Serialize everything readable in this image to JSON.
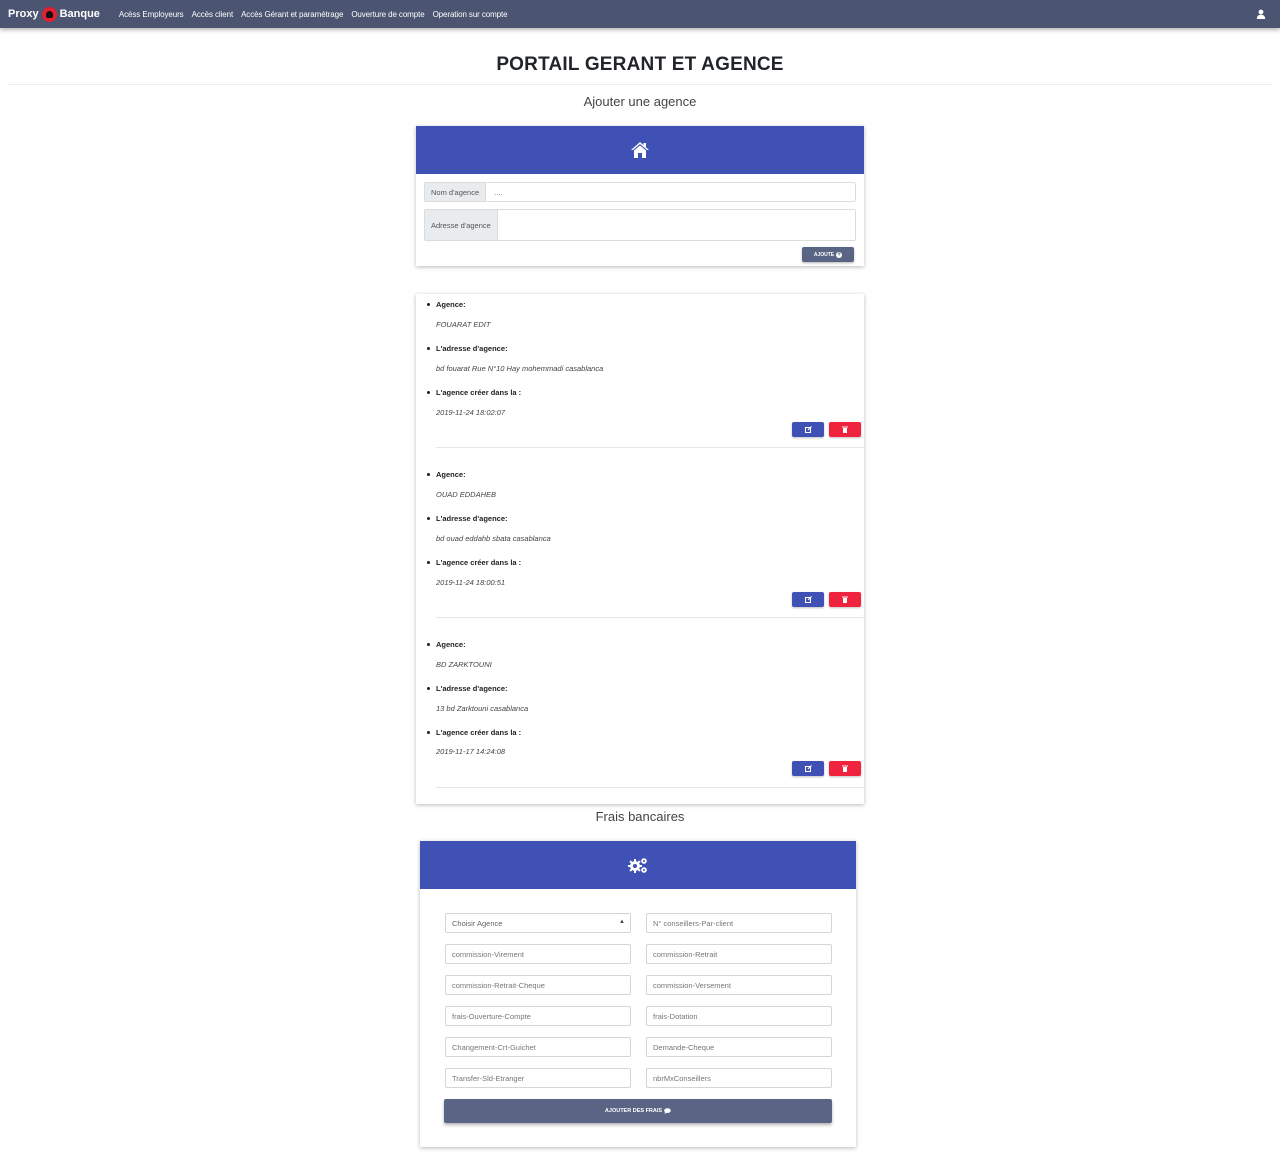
{
  "nav": {
    "brand_left": "Proxy",
    "brand_right": "Banque",
    "links": [
      "Acèss Employeurs",
      "Accès client",
      "Accès Gérant et paramétrage",
      "Ouverture de compte",
      "Operation sur compte"
    ]
  },
  "page": {
    "title": "PORTAIL GERANT ET AGENCE",
    "add_agency_title": "Ajouter une agence",
    "frais_title": "Frais bancaires"
  },
  "agency_form": {
    "name_label": "Nom d'agence",
    "name_placeholder": "....",
    "address_label": "Adresse d'agence",
    "submit_label": "AJOUTE"
  },
  "agency_fields": {
    "name_label": "Agence:",
    "address_label": "L'adresse d'agence:",
    "date_label": "L'agence créer dans la :"
  },
  "agencies": [
    {
      "name": "FOUARAT EDIT",
      "address": "bd fouarat Rue N°10 Hay mohemmadi casablanca",
      "created": "2019-11-24 18:02:07"
    },
    {
      "name": "OUAD EDDAHEB",
      "address": "bd ouad eddahb sbata casablanca",
      "created": "2019-11-24 18:00:51"
    },
    {
      "name": "BD ZARKTOUNI",
      "address": "13 bd Zarktouni casablanca",
      "created": "2019-11-17 14:24:08"
    }
  ],
  "frais_form": {
    "select_label": "Choisir Agence",
    "fields": [
      "N° conseillers-Par-client",
      "commission-Virement",
      "commission-Retrait",
      "commission-Retrait-Cheque",
      "commission-Versement",
      "frais-Ouverture-Compte",
      "frais-Dotation",
      "Changement-Crt-Guichet",
      "Demande-Cheque",
      "Transfer-Sld-Etranger",
      "nbrMxConseillers"
    ],
    "submit_label": "AJOUTER DES FRAIS"
  },
  "colors": {
    "navbar": "#4b5470",
    "primary": "#3f51b5",
    "danger": "#f0233f",
    "button": "#5a6586"
  }
}
